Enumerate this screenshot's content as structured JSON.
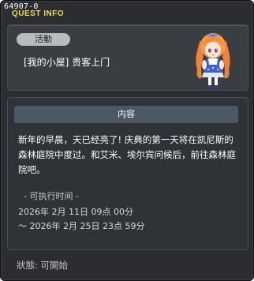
{
  "window": {
    "id_label": "64907-0",
    "title": "QUEST INFO"
  },
  "quest": {
    "category": "活動",
    "name": "[我的小屋] 贵客上门"
  },
  "content": {
    "header": "内容",
    "description": "新年的早晨，天已经亮了! 庆典的第一天将在凯尼斯的森林庭院中度过。和艾米、埃尔宾问候后，前往森林庭院吧。",
    "schedule_header": "- 可执行时间 -",
    "schedule_start": "2026年 2月 11日 09点 00分",
    "schedule_end": "～ 2026年 2月 25日 23点 59分"
  },
  "status": {
    "text": "狀態: 可開始"
  },
  "icons": {
    "portrait": "npc-portrait-icon"
  }
}
